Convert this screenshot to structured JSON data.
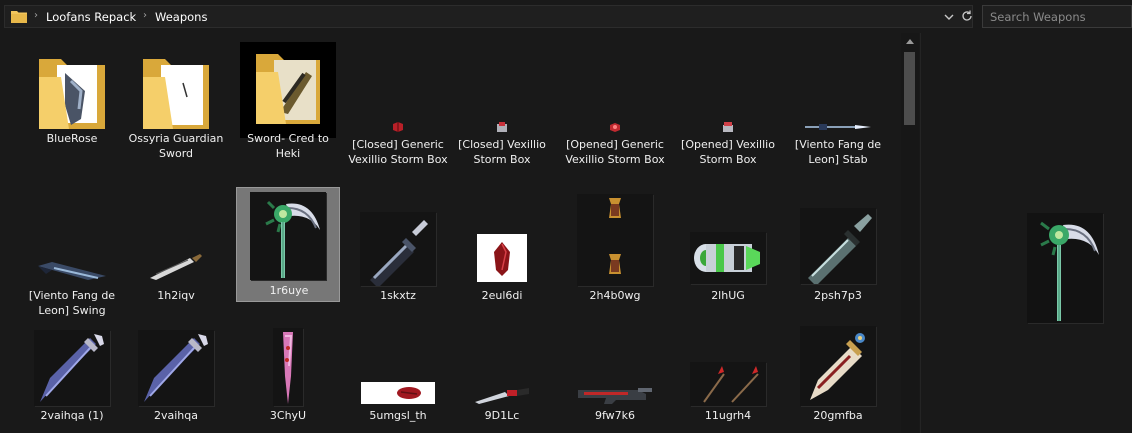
{
  "address_bar": {
    "breadcrumbs": [
      "Loofans Repack",
      "Weapons"
    ],
    "search_placeholder": "Search Weapons"
  },
  "files": {
    "row1": [
      {
        "name": "BlueRose",
        "icon": "folder-icon"
      },
      {
        "name": "Ossyria Guardian Sword",
        "icon": "folder-icon"
      },
      {
        "name": "Sword- Cred to Heki",
        "icon": "folder-icon"
      },
      {
        "name": "[Closed] Generic Vexillio Storm Box",
        "icon": "box-icon"
      },
      {
        "name": "[Closed] Vexillio Storm Box",
        "icon": "box-icon"
      },
      {
        "name": "[Opened] Generic Vexillio Storm Box",
        "icon": "box-icon"
      },
      {
        "name": "[Opened] Vexillio Storm Box",
        "icon": "box-icon"
      },
      {
        "name": "[Viento Fang de Leon] Stab",
        "icon": "spear-icon"
      }
    ],
    "row2": [
      {
        "name": "[Viento Fang de Leon] Swing",
        "icon": "blade-icon"
      },
      {
        "name": "1h2iqv",
        "icon": "blade-icon"
      },
      {
        "name": "1r6uye",
        "icon": "scythe-icon",
        "selected": true
      },
      {
        "name": "1skxtz",
        "icon": "sword-icon"
      },
      {
        "name": "2eul6di",
        "icon": "gem-icon"
      },
      {
        "name": "2h4b0wg",
        "icon": "pillar-icon"
      },
      {
        "name": "2lhUG",
        "icon": "cannon-icon"
      },
      {
        "name": "2psh7p3",
        "icon": "sword-icon"
      }
    ],
    "row3": [
      {
        "name": "2vaihqa (1)",
        "icon": "greatsword-icon"
      },
      {
        "name": "2vaihqa",
        "icon": "greatsword-icon"
      },
      {
        "name": "3ChyU",
        "icon": "bat-icon"
      },
      {
        "name": "5umgsl_th",
        "icon": "gem-icon"
      },
      {
        "name": "9D1Lc",
        "icon": "knife-icon"
      },
      {
        "name": "9fw7k6",
        "icon": "rifle-icon"
      },
      {
        "name": "11ugrh4",
        "icon": "arrow-icon"
      },
      {
        "name": "20gmfba",
        "icon": "ornate-sword-icon"
      }
    ]
  },
  "colors": {
    "background": "#191919",
    "selected": "#777777",
    "folder": "#f2c55c"
  }
}
